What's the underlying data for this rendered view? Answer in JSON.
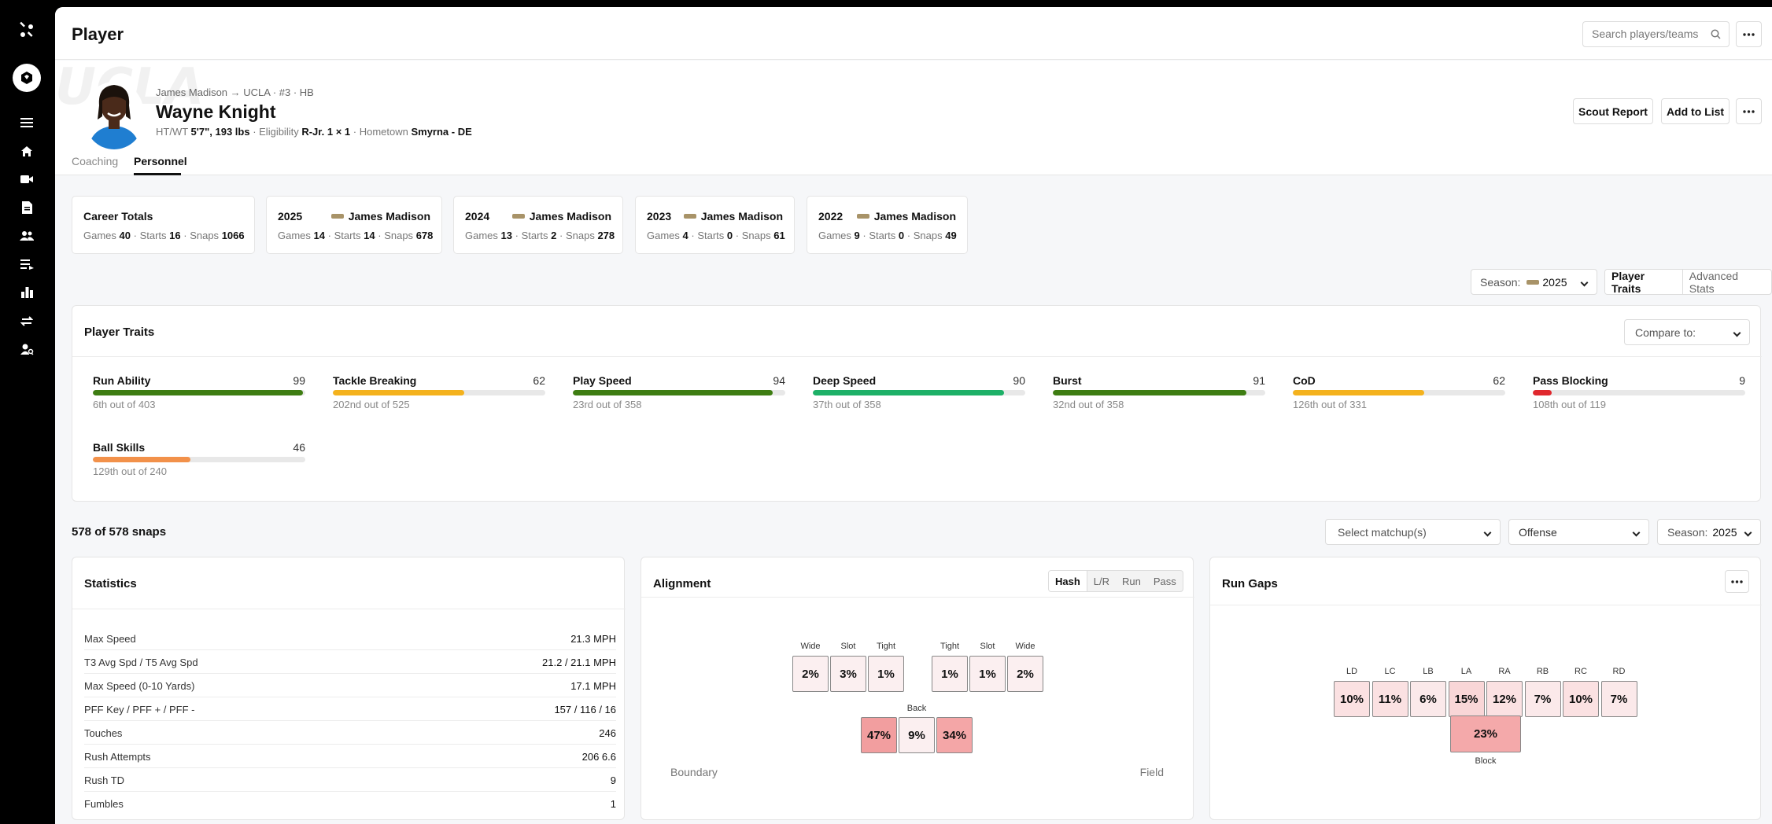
{
  "header": {
    "title": "Player",
    "search_placeholder": "Search players/teams"
  },
  "profile": {
    "meta": "James Madison → UCLA · #3 · HB",
    "name": "Wayne Knight",
    "ht_wt_label": "HT/WT",
    "ht_wt": "5'7\", 193 lbs",
    "eligibility_label": "Eligibility",
    "eligibility": "R-Jr. 1 × 1",
    "hometown_label": "Hometown",
    "hometown": "Smyrna - DE",
    "scout_report": "Scout Report",
    "add_to_list": "Add to List",
    "tabs": [
      "Coaching",
      "Personnel"
    ],
    "active_tab": "Personnel"
  },
  "season_cards": [
    {
      "title": "Career Totals",
      "team": "",
      "games": "40",
      "starts": "16",
      "snaps": "1066"
    },
    {
      "title": "2025",
      "team": "James Madison",
      "games": "14",
      "starts": "14",
      "snaps": "678"
    },
    {
      "title": "2024",
      "team": "James Madison",
      "games": "13",
      "starts": "2",
      "snaps": "278"
    },
    {
      "title": "2023",
      "team": "James Madison",
      "games": "4",
      "starts": "0",
      "snaps": "61"
    },
    {
      "title": "2022",
      "team": "James Madison",
      "games": "9",
      "starts": "0",
      "snaps": "49"
    }
  ],
  "labels": {
    "games": "Games",
    "starts": "Starts",
    "snaps": "Snaps"
  },
  "season_filter": {
    "label": "Season:",
    "value": "2025"
  },
  "view_toggle": [
    "Player Traits",
    "Advanced Stats"
  ],
  "traits_panel": {
    "title": "Player Traits",
    "compare_placeholder": "Compare to:",
    "traits": [
      {
        "name": "Run Ability",
        "value": 99,
        "rank": "6th out of 403",
        "color": "#3e7d12"
      },
      {
        "name": "Tackle Breaking",
        "value": 62,
        "rank": "202nd out of 525",
        "color": "#f4b21d"
      },
      {
        "name": "Play Speed",
        "value": 94,
        "rank": "23rd out of 358",
        "color": "#3e7d12"
      },
      {
        "name": "Deep Speed",
        "value": 90,
        "rank": "37th out of 358",
        "color": "#1db067"
      },
      {
        "name": "Burst",
        "value": 91,
        "rank": "32nd out of 358",
        "color": "#3e7d12"
      },
      {
        "name": "CoD",
        "value": 62,
        "rank": "126th out of 331",
        "color": "#f4b21d"
      },
      {
        "name": "Pass Blocking",
        "value": 9,
        "rank": "108th out of 119",
        "color": "#e0282e"
      },
      {
        "name": "Ball Skills",
        "value": 46,
        "rank": "129th out of 240",
        "color": "#f2914a"
      }
    ]
  },
  "snaps": {
    "title": "578 of 578 snaps",
    "matchup_placeholder": "Select matchup(s)",
    "side": "Offense",
    "season_label": "Season:",
    "season_value": "2025"
  },
  "statistics": {
    "title": "Statistics",
    "rows": [
      {
        "k": "Max Speed",
        "v": "21.3 MPH"
      },
      {
        "k": "T3 Avg Spd / T5 Avg Spd",
        "v": "21.2 / 21.1 MPH"
      },
      {
        "k": "Max Speed (0-10 Yards)",
        "v": "17.1 MPH"
      },
      {
        "k": "PFF Key / PFF + / PFF -",
        "v": "157 / 116 / 16"
      },
      {
        "k": "Touches",
        "v": "246"
      },
      {
        "k": "Rush Attempts",
        "v": "206 6.6"
      },
      {
        "k": "Rush TD",
        "v": "9"
      },
      {
        "k": "Fumbles",
        "v": "1"
      }
    ]
  },
  "alignment": {
    "title": "Alignment",
    "toggles": [
      "Hash",
      "L/R",
      "Run",
      "Pass"
    ],
    "left": [
      {
        "label": "Wide",
        "value": "2%",
        "color": "#fbeff0"
      },
      {
        "label": "Slot",
        "value": "3%",
        "color": "#fbeff0"
      },
      {
        "label": "Tight",
        "value": "1%",
        "color": "#fbeff0"
      }
    ],
    "right": [
      {
        "label": "Tight",
        "value": "1%",
        "color": "#fbeff0"
      },
      {
        "label": "Slot",
        "value": "1%",
        "color": "#fbeff0"
      },
      {
        "label": "Wide",
        "value": "2%",
        "color": "#fbeff0"
      }
    ],
    "back_label": "Back",
    "back": [
      {
        "value": "47%",
        "color": "#f29e9f"
      },
      {
        "value": "9%",
        "color": "#fbeff0"
      },
      {
        "value": "34%",
        "color": "#f4a6a7"
      }
    ],
    "boundary": "Boundary",
    "field": "Field"
  },
  "run_gaps": {
    "title": "Run Gaps",
    "gaps": [
      {
        "label": "LD",
        "value": "10%",
        "color": "#fbe1e2"
      },
      {
        "label": "LC",
        "value": "11%",
        "color": "#fbe1e2"
      },
      {
        "label": "LB",
        "value": "6%",
        "color": "#fbe9ea"
      },
      {
        "label": "LA",
        "value": "15%",
        "color": "#f9d6d7"
      },
      {
        "label": "RA",
        "value": "12%",
        "color": "#fbe1e2"
      },
      {
        "label": "RB",
        "value": "7%",
        "color": "#fbe9ea"
      },
      {
        "label": "RC",
        "value": "10%",
        "color": "#fbe1e2"
      },
      {
        "label": "RD",
        "value": "7%",
        "color": "#fbe9ea"
      }
    ],
    "block_value": "23%",
    "block_label": "Block",
    "block_color": "#f4a9aa"
  }
}
